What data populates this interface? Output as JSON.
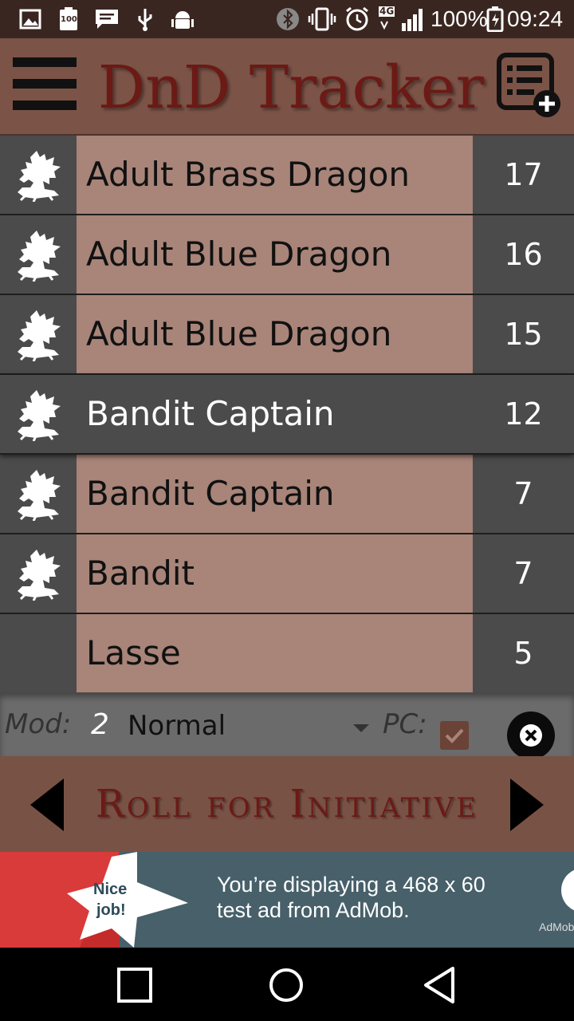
{
  "status_bar": {
    "battery_text": "100%",
    "time": "09:24",
    "network_label": "4G",
    "notif_badge": "100"
  },
  "header": {
    "title": "DnD Tracker"
  },
  "entries": [
    {
      "name": "Adult Brass Dragon",
      "initiative": "17",
      "has_icon": true,
      "active": false
    },
    {
      "name": "Adult Blue Dragon",
      "initiative": "16",
      "has_icon": true,
      "active": false
    },
    {
      "name": "Adult Blue Dragon",
      "initiative": "15",
      "has_icon": true,
      "active": false
    },
    {
      "name": "Bandit Captain",
      "initiative": "12",
      "has_icon": true,
      "active": true
    },
    {
      "name": "Bandit Captain",
      "initiative": "7",
      "has_icon": true,
      "active": false
    },
    {
      "name": "Bandit",
      "initiative": "7",
      "has_icon": true,
      "active": false
    },
    {
      "name": "Lasse",
      "initiative": "5",
      "has_icon": false,
      "active": false
    }
  ],
  "mod_bar": {
    "mod_label": "Mod:",
    "mod_value": "2",
    "roll_mode": "Normal",
    "pc_label": "PC:",
    "pc_checked": true
  },
  "roll_bar": {
    "label": "Roll for Initiative"
  },
  "ad": {
    "badge_line1": "Nice",
    "badge_line2": "job!",
    "text_line1": "You’re displaying a 468 x 60",
    "text_line2": "test ad from AdMob.",
    "brand": "AdMob"
  },
  "colors": {
    "header_bg": "#7b5347",
    "title_color": "#6b1a16",
    "name_cell_bg": "#a88479",
    "dark_cell_bg": "#4b4b4b"
  }
}
